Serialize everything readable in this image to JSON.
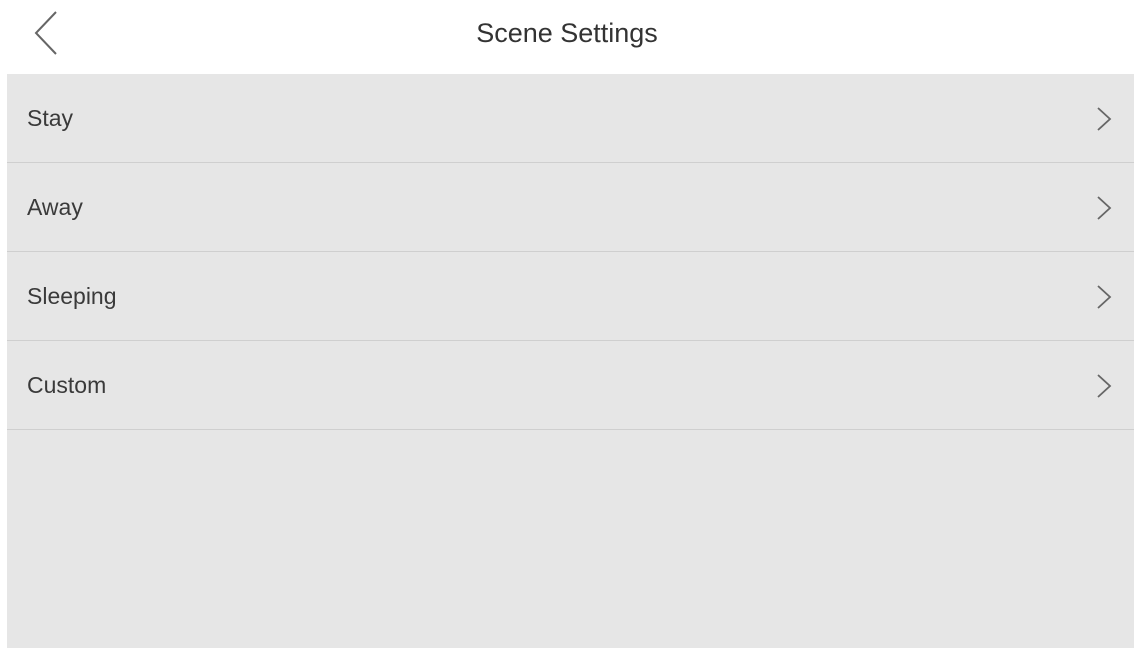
{
  "header": {
    "title": "Scene Settings",
    "back_icon": "chevron-left-icon"
  },
  "scenes": {
    "items": [
      {
        "label": "Stay",
        "icon": "chevron-right-icon"
      },
      {
        "label": "Away",
        "icon": "chevron-right-icon"
      },
      {
        "label": "Sleeping",
        "icon": "chevron-right-icon"
      },
      {
        "label": "Custom",
        "icon": "chevron-right-icon"
      }
    ]
  },
  "colors": {
    "background": "#ffffff",
    "panel": "#e6e6e6",
    "divider": "#cfcfcf",
    "text": "#3a3a3a",
    "icon": "#666666"
  }
}
